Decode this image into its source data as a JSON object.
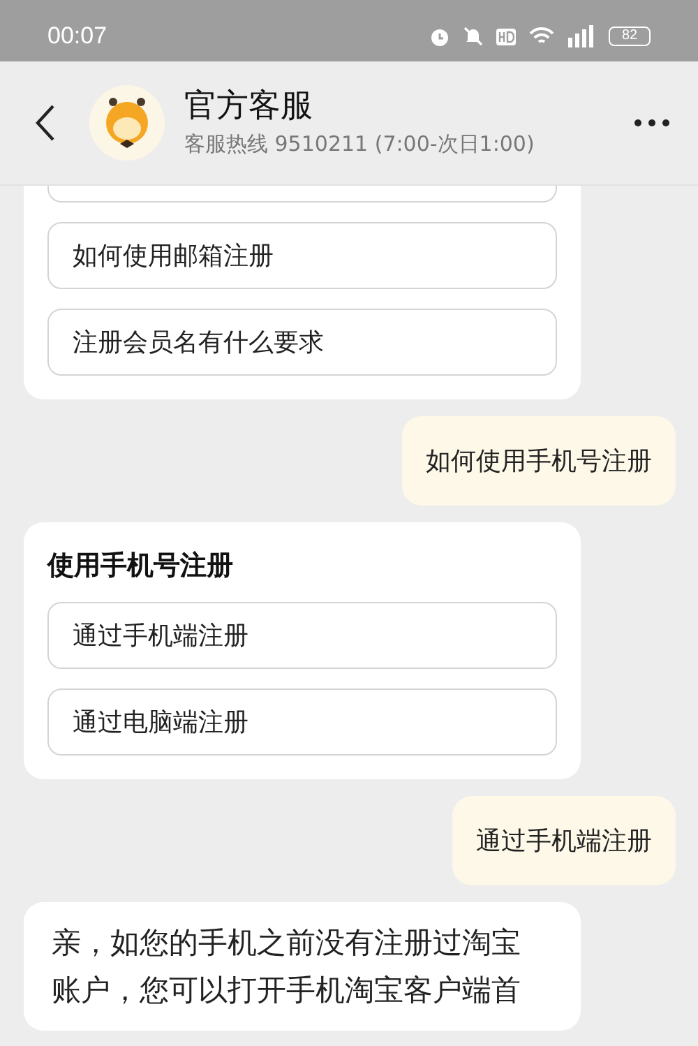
{
  "status_bar": {
    "time": "00:07",
    "battery": "82"
  },
  "header": {
    "title": "官方客服",
    "subtitle": "客服热线 9510211 (7:00-次日1:00)"
  },
  "messages": [
    {
      "kind": "card",
      "cut_top": true,
      "options": [
        "如何使用邮箱注册",
        "注册会员名有什么要求"
      ]
    },
    {
      "kind": "user",
      "text": "如何使用手机号注册"
    },
    {
      "kind": "card",
      "title": "使用手机号注册",
      "options": [
        "通过手机端注册",
        "通过电脑端注册"
      ]
    },
    {
      "kind": "user",
      "text": "通过手机端注册"
    },
    {
      "kind": "bot",
      "text": "亲，如您的手机之前没有注册过淘宝账户，您可以打开手机淘宝客户端首"
    }
  ]
}
